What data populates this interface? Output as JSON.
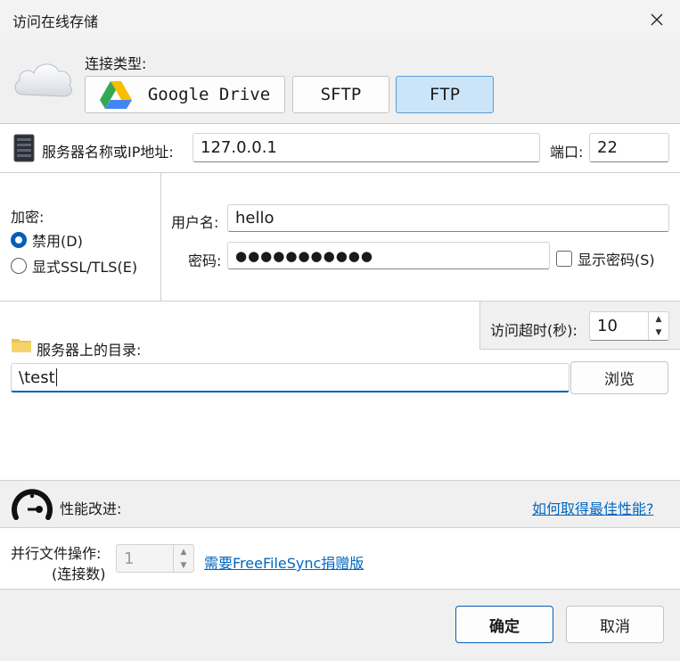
{
  "window": {
    "title": "访问在线存储"
  },
  "connection": {
    "label": "连接类型:",
    "types": [
      "Google Drive",
      "SFTP",
      "FTP"
    ],
    "selected": "FTP"
  },
  "server": {
    "label": "服务器名称或IP地址:",
    "value": "127.0.0.1",
    "port_label": "端口:",
    "port_value": "22"
  },
  "encryption": {
    "label": "加密:",
    "options": [
      "禁用(D)",
      "显式SSL/TLS(E)"
    ],
    "selected": "禁用(D)"
  },
  "credentials": {
    "username_label": "用户名:",
    "username": "hello",
    "password_label": "密码:",
    "password_mask": "●●●●●●●●●●●",
    "show_password_label": "显示密码(S)",
    "show_password_checked": false
  },
  "timeout": {
    "label": "访问超时(秒):",
    "value": "10"
  },
  "directory": {
    "label": "服务器上的目录:",
    "value": "\\test",
    "browse_label": "浏览"
  },
  "performance": {
    "label": "性能改进:",
    "help_link": "如何取得最佳性能?",
    "parallel_label_1": "并行文件操作:",
    "parallel_label_2": "(连接数)",
    "parallel_value": "1",
    "donation_link": "需要FreeFileSync捐赠版"
  },
  "buttons": {
    "ok": "确定",
    "cancel": "取消"
  },
  "colors": {
    "accent": "#005fb8",
    "selected_button": "#cce4f7",
    "link": "#0067c0"
  }
}
